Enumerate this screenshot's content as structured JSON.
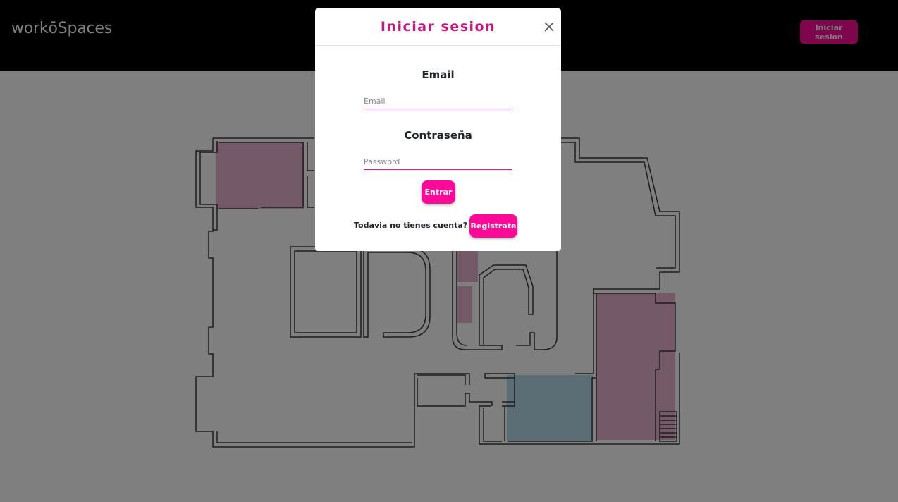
{
  "header": {
    "brand": "workōSpaces",
    "login_label": "Iniciar sesion"
  },
  "floorplan": {
    "colors": {
      "wall": "#3a3a3a",
      "desk_zone": "#e8b4d0",
      "meeting_zone": "#b7dced",
      "background": "#ffffff"
    }
  },
  "modal": {
    "title": "Iniciar sesion",
    "close_icon": "close-x-icon",
    "email_label": "Email",
    "email_placeholder": "Email",
    "email_value": "",
    "password_label": "Contraseña",
    "password_placeholder": "Password",
    "password_value": "",
    "enter_label": "Entrar",
    "no_account_text": "Todavia no tienes cuenta?",
    "register_label": "Registrate"
  },
  "colors": {
    "accent": "#ff0a98",
    "title": "#c4177f",
    "header_bg": "#000000",
    "backdrop": "rgba(0,0,0,0.5)"
  }
}
